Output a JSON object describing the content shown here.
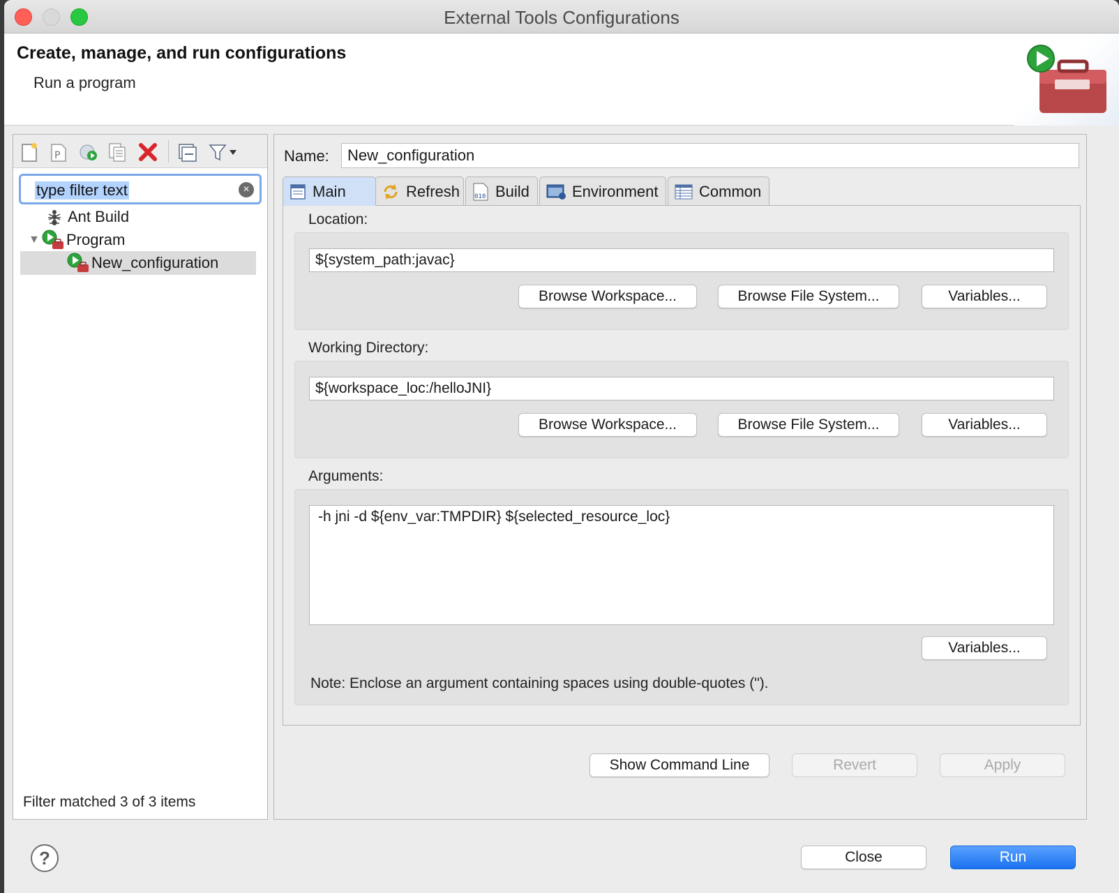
{
  "window": {
    "title": "External Tools Configurations"
  },
  "header": {
    "title": "Create, manage, and run configurations",
    "subtitle": "Run a program"
  },
  "left": {
    "filter": {
      "value": "type filter text"
    },
    "tree": [
      {
        "label": "Ant Build"
      },
      {
        "label": "Program"
      },
      {
        "label": "New_configuration"
      }
    ],
    "status": "Filter matched 3 of 3 items"
  },
  "config": {
    "name_label": "Name:",
    "name_value": "New_configuration",
    "tabs": [
      {
        "label": "Main"
      },
      {
        "label": "Refresh"
      },
      {
        "label": "Build"
      },
      {
        "label": "Environment"
      },
      {
        "label": "Common"
      }
    ],
    "location": {
      "label": "Location:",
      "value": "${system_path:javac}"
    },
    "working_dir": {
      "label": "Working Directory:",
      "value": "${workspace_loc:/helloJNI}"
    },
    "arguments": {
      "label": "Arguments:",
      "value": "-h jni -d ${env_var:TMPDIR} ${selected_resource_loc}"
    },
    "buttons": {
      "browse_workspace": "Browse Workspace...",
      "browse_fs": "Browse File System...",
      "variables": "Variables..."
    },
    "note": "Note: Enclose an argument containing spaces using double-quotes (\")."
  },
  "actions": {
    "show_cmd": "Show Command Line",
    "revert": "Revert",
    "apply": "Apply"
  },
  "footer": {
    "close": "Close",
    "run": "Run"
  },
  "colors": {
    "accent": "#1a72f0",
    "selection": "#b3d3ff",
    "delete": "#d9262b"
  }
}
